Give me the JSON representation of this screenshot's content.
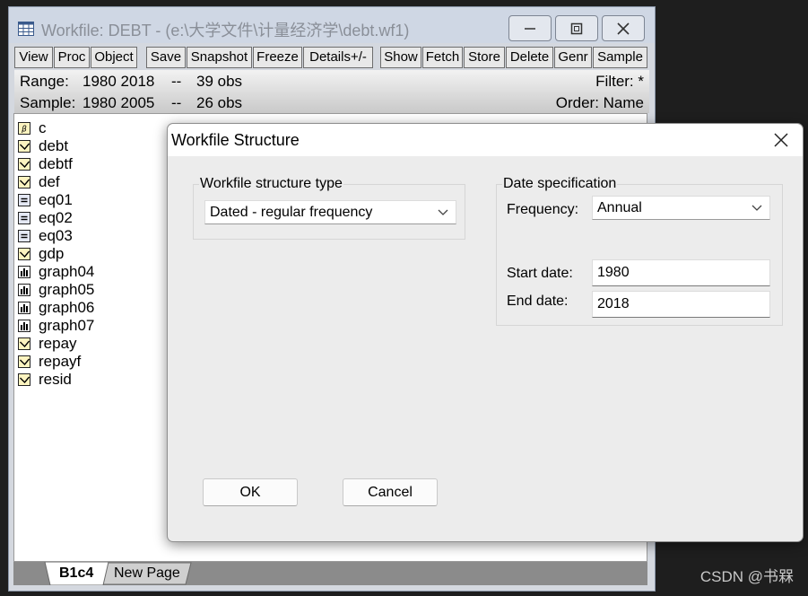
{
  "workfile_window": {
    "title": "Workfile: DEBT - (e:\\大学文件\\计量经济学\\debt.wf1)",
    "toolbar": [
      "View",
      "Proc",
      "Object",
      "Save",
      "Snapshot",
      "Freeze",
      "Details+/-",
      "Show",
      "Fetch",
      "Store",
      "Delete",
      "Genr",
      "Sample"
    ],
    "info": {
      "range_label": "Range:",
      "range_value": "1980 2018",
      "range_sep": "--",
      "range_obs": "39 obs",
      "filter": "Filter: *",
      "sample_label": "Sample:",
      "sample_value": "1980 2005",
      "sample_sep": "--",
      "sample_obs": "26 obs",
      "order": "Order: Name"
    },
    "objects": [
      {
        "name": "c",
        "icon": "coef-icon"
      },
      {
        "name": "debt",
        "icon": "series-icon"
      },
      {
        "name": "debtf",
        "icon": "series-icon"
      },
      {
        "name": "def",
        "icon": "series-icon"
      },
      {
        "name": "eq01",
        "icon": "equation-icon"
      },
      {
        "name": "eq02",
        "icon": "equation-icon"
      },
      {
        "name": "eq03",
        "icon": "equation-icon"
      },
      {
        "name": "gdp",
        "icon": "series-icon"
      },
      {
        "name": "graph04",
        "icon": "graph-icon"
      },
      {
        "name": "graph05",
        "icon": "graph-icon"
      },
      {
        "name": "graph06",
        "icon": "graph-icon"
      },
      {
        "name": "graph07",
        "icon": "graph-icon"
      },
      {
        "name": "repay",
        "icon": "series-icon"
      },
      {
        "name": "repayf",
        "icon": "series-icon"
      },
      {
        "name": "resid",
        "icon": "series-icon"
      }
    ],
    "tabs": [
      "B1c4",
      "New Page"
    ]
  },
  "dialog": {
    "title": "Workfile Structure",
    "structure_group_label": "Workfile structure type",
    "structure_type": "Dated - regular frequency",
    "date_group_label": "Date specification",
    "frequency_label": "Frequency:",
    "frequency": "Annual",
    "start_label": "Start date:",
    "start_date": "1980",
    "end_label": "End date:",
    "end_date": "2018",
    "ok_label": "OK",
    "cancel_label": "Cancel"
  },
  "watermark": "CSDN @书槑"
}
